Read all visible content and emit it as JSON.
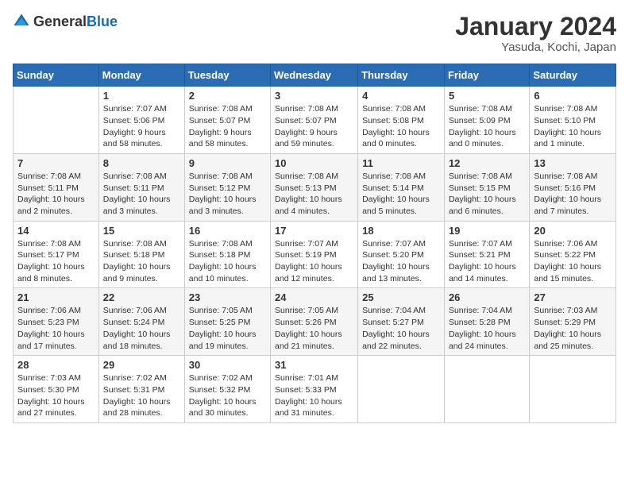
{
  "header": {
    "logo_general": "General",
    "logo_blue": "Blue",
    "main_title": "January 2024",
    "subtitle": "Yasuda, Kochi, Japan"
  },
  "calendar": {
    "days_of_week": [
      "Sunday",
      "Monday",
      "Tuesday",
      "Wednesday",
      "Thursday",
      "Friday",
      "Saturday"
    ],
    "weeks": [
      [
        {
          "day": "",
          "info": ""
        },
        {
          "day": "1",
          "info": "Sunrise: 7:07 AM\nSunset: 5:06 PM\nDaylight: 9 hours\nand 58 minutes."
        },
        {
          "day": "2",
          "info": "Sunrise: 7:08 AM\nSunset: 5:07 PM\nDaylight: 9 hours\nand 58 minutes."
        },
        {
          "day": "3",
          "info": "Sunrise: 7:08 AM\nSunset: 5:07 PM\nDaylight: 9 hours\nand 59 minutes."
        },
        {
          "day": "4",
          "info": "Sunrise: 7:08 AM\nSunset: 5:08 PM\nDaylight: 10 hours\nand 0 minutes."
        },
        {
          "day": "5",
          "info": "Sunrise: 7:08 AM\nSunset: 5:09 PM\nDaylight: 10 hours\nand 0 minutes."
        },
        {
          "day": "6",
          "info": "Sunrise: 7:08 AM\nSunset: 5:10 PM\nDaylight: 10 hours\nand 1 minute."
        }
      ],
      [
        {
          "day": "7",
          "info": "Sunrise: 7:08 AM\nSunset: 5:11 PM\nDaylight: 10 hours\nand 2 minutes."
        },
        {
          "day": "8",
          "info": "Sunrise: 7:08 AM\nSunset: 5:11 PM\nDaylight: 10 hours\nand 3 minutes."
        },
        {
          "day": "9",
          "info": "Sunrise: 7:08 AM\nSunset: 5:12 PM\nDaylight: 10 hours\nand 3 minutes."
        },
        {
          "day": "10",
          "info": "Sunrise: 7:08 AM\nSunset: 5:13 PM\nDaylight: 10 hours\nand 4 minutes."
        },
        {
          "day": "11",
          "info": "Sunrise: 7:08 AM\nSunset: 5:14 PM\nDaylight: 10 hours\nand 5 minutes."
        },
        {
          "day": "12",
          "info": "Sunrise: 7:08 AM\nSunset: 5:15 PM\nDaylight: 10 hours\nand 6 minutes."
        },
        {
          "day": "13",
          "info": "Sunrise: 7:08 AM\nSunset: 5:16 PM\nDaylight: 10 hours\nand 7 minutes."
        }
      ],
      [
        {
          "day": "14",
          "info": "Sunrise: 7:08 AM\nSunset: 5:17 PM\nDaylight: 10 hours\nand 8 minutes."
        },
        {
          "day": "15",
          "info": "Sunrise: 7:08 AM\nSunset: 5:18 PM\nDaylight: 10 hours\nand 9 minutes."
        },
        {
          "day": "16",
          "info": "Sunrise: 7:08 AM\nSunset: 5:18 PM\nDaylight: 10 hours\nand 10 minutes."
        },
        {
          "day": "17",
          "info": "Sunrise: 7:07 AM\nSunset: 5:19 PM\nDaylight: 10 hours\nand 12 minutes."
        },
        {
          "day": "18",
          "info": "Sunrise: 7:07 AM\nSunset: 5:20 PM\nDaylight: 10 hours\nand 13 minutes."
        },
        {
          "day": "19",
          "info": "Sunrise: 7:07 AM\nSunset: 5:21 PM\nDaylight: 10 hours\nand 14 minutes."
        },
        {
          "day": "20",
          "info": "Sunrise: 7:06 AM\nSunset: 5:22 PM\nDaylight: 10 hours\nand 15 minutes."
        }
      ],
      [
        {
          "day": "21",
          "info": "Sunrise: 7:06 AM\nSunset: 5:23 PM\nDaylight: 10 hours\nand 17 minutes."
        },
        {
          "day": "22",
          "info": "Sunrise: 7:06 AM\nSunset: 5:24 PM\nDaylight: 10 hours\nand 18 minutes."
        },
        {
          "day": "23",
          "info": "Sunrise: 7:05 AM\nSunset: 5:25 PM\nDaylight: 10 hours\nand 19 minutes."
        },
        {
          "day": "24",
          "info": "Sunrise: 7:05 AM\nSunset: 5:26 PM\nDaylight: 10 hours\nand 21 minutes."
        },
        {
          "day": "25",
          "info": "Sunrise: 7:04 AM\nSunset: 5:27 PM\nDaylight: 10 hours\nand 22 minutes."
        },
        {
          "day": "26",
          "info": "Sunrise: 7:04 AM\nSunset: 5:28 PM\nDaylight: 10 hours\nand 24 minutes."
        },
        {
          "day": "27",
          "info": "Sunrise: 7:03 AM\nSunset: 5:29 PM\nDaylight: 10 hours\nand 25 minutes."
        }
      ],
      [
        {
          "day": "28",
          "info": "Sunrise: 7:03 AM\nSunset: 5:30 PM\nDaylight: 10 hours\nand 27 minutes."
        },
        {
          "day": "29",
          "info": "Sunrise: 7:02 AM\nSunset: 5:31 PM\nDaylight: 10 hours\nand 28 minutes."
        },
        {
          "day": "30",
          "info": "Sunrise: 7:02 AM\nSunset: 5:32 PM\nDaylight: 10 hours\nand 30 minutes."
        },
        {
          "day": "31",
          "info": "Sunrise: 7:01 AM\nSunset: 5:33 PM\nDaylight: 10 hours\nand 31 minutes."
        },
        {
          "day": "",
          "info": ""
        },
        {
          "day": "",
          "info": ""
        },
        {
          "day": "",
          "info": ""
        }
      ]
    ]
  }
}
